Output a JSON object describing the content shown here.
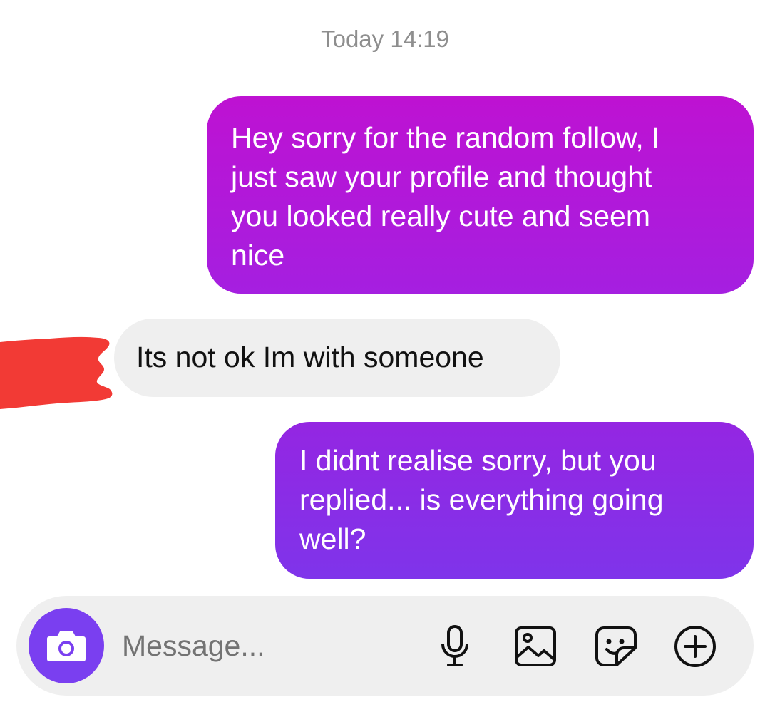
{
  "conversation": {
    "timestamp": "Today 14:19",
    "messages": [
      {
        "direction": "outgoing",
        "lines": [
          "Hey sorry for the random follow, I",
          "just saw your profile and thought",
          "you looked really cute and seem",
          "nice"
        ]
      },
      {
        "direction": "incoming",
        "lines": [
          "Its not ok Im with someone"
        ]
      },
      {
        "direction": "outgoing",
        "lines": [
          "I didnt realise sorry, but you",
          "replied... is everything going",
          "well?"
        ]
      }
    ]
  },
  "composer": {
    "placeholder": "Message...",
    "value": "",
    "icons": [
      "camera-icon",
      "microphone-icon",
      "gallery-icon",
      "sticker-icon",
      "plus-icon"
    ]
  },
  "colors": {
    "outgoing_bubble_1": "#be12d2",
    "outgoing_bubble_2": "#8a2ee6",
    "incoming_bubble": "#efefef",
    "camera_button": "#7a3ff0",
    "redaction": "#f23a35"
  }
}
